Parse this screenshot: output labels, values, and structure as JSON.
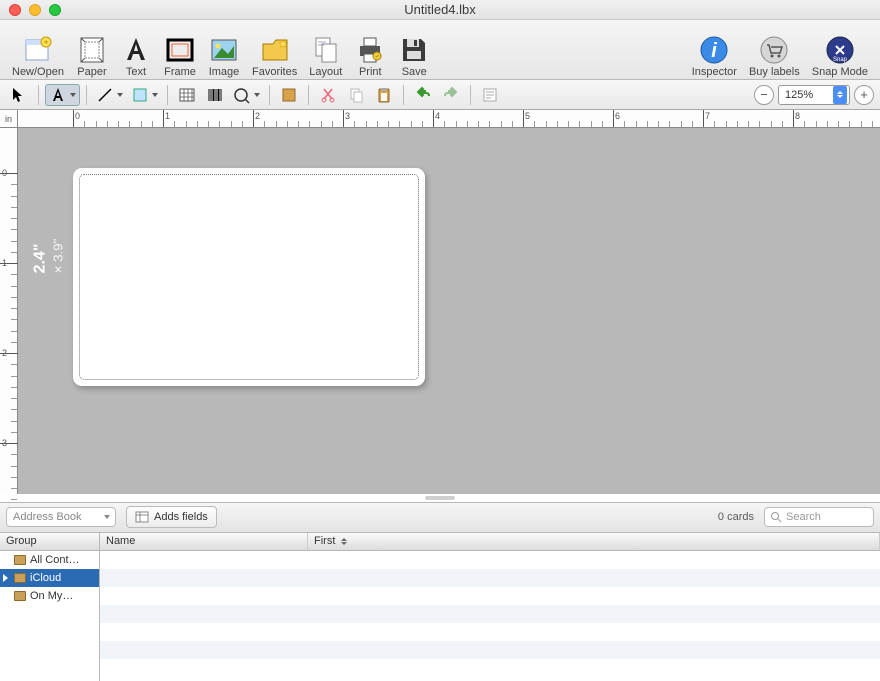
{
  "window": {
    "title": "Untitled4.lbx"
  },
  "toolbar_main": {
    "new_open": "New/Open",
    "paper": "Paper",
    "text": "Text",
    "frame": "Frame",
    "image": "Image",
    "favorites": "Favorites",
    "layout": "Layout",
    "print": "Print",
    "save": "Save",
    "inspector": "Inspector",
    "buy_labels": "Buy labels",
    "snap_mode": "Snap Mode"
  },
  "ruler_unit": "in",
  "zoom_level": "125%",
  "label_dimensions": {
    "h": "2.4\"",
    "w": "× 3.9\""
  },
  "bottom_bar": {
    "source": "Address Book",
    "adds_fields": "Adds fields",
    "card_count": "0 cards",
    "search_placeholder": "Search"
  },
  "columns": {
    "group": "Group",
    "name": "Name",
    "first": "First"
  },
  "groups": [
    {
      "label": "All Cont…",
      "selected": false
    },
    {
      "label": "iCloud",
      "selected": true
    },
    {
      "label": "On My…",
      "selected": false
    }
  ]
}
